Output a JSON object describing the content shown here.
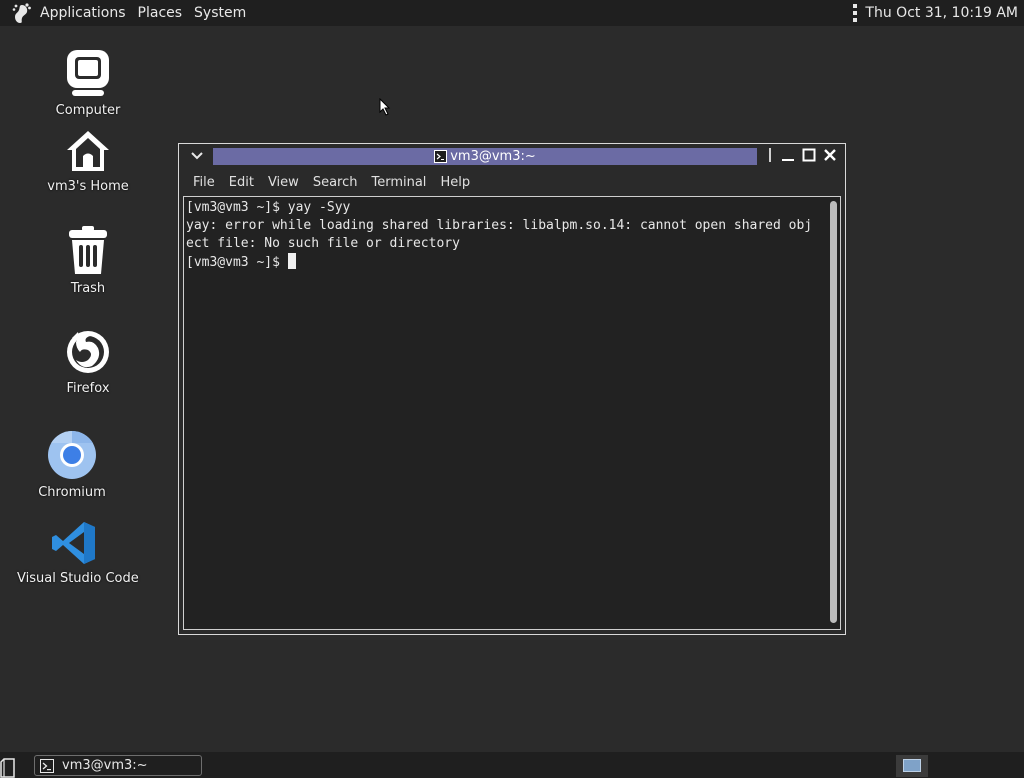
{
  "top_panel": {
    "menus": [
      "Applications",
      "Places",
      "System"
    ],
    "clock": "Thu Oct 31, 10:19 AM",
    "icons": {
      "logo": "gnome-foot-icon",
      "menu": "kebab-menu-icon"
    }
  },
  "desktop": {
    "icons": [
      {
        "label": "Computer",
        "icon": "computer-icon"
      },
      {
        "label": "vm3's Home",
        "icon": "home-icon"
      },
      {
        "label": "Trash",
        "icon": "trash-icon"
      },
      {
        "label": "Firefox",
        "icon": "firefox-icon"
      },
      {
        "label": "Chromium",
        "icon": "chromium-icon"
      },
      {
        "label": "Visual Studio Code",
        "icon": "vscode-icon"
      }
    ]
  },
  "terminal": {
    "title": "vm3@vm3:~",
    "menu": [
      "File",
      "Edit",
      "View",
      "Search",
      "Terminal",
      "Help"
    ],
    "lines": [
      "[vm3@vm3 ~]$ yay -Syy",
      "yay: error while loading shared libraries: libalpm.so.14: cannot open shared obj",
      "ect file: No such file or directory"
    ],
    "prompt": "[vm3@vm3 ~]$ "
  },
  "taskbar": {
    "window_button": "vm3@vm3:~"
  },
  "colors": {
    "desktop_bg": "#2b2b2b",
    "panel_bg": "#1f1f1f",
    "title_strip": "#6b6ba4",
    "vscode_blue": "#2f8fe0",
    "chromium_blue": "#3d7fe6"
  }
}
